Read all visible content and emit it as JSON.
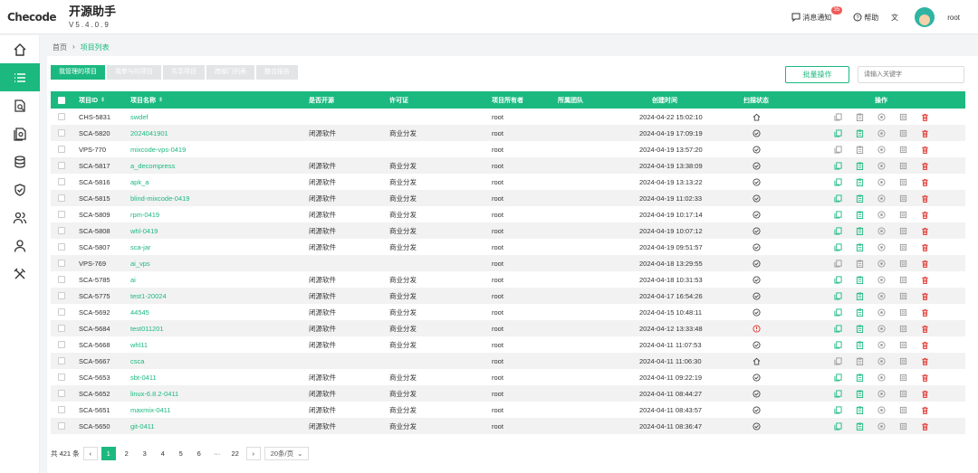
{
  "header": {
    "logo_text": "Checode",
    "app_name": "开源助手",
    "version": "V5.4.0.9",
    "messages_label": "消息通知",
    "messages_count": "35",
    "help_label": "帮助",
    "user_name": "root"
  },
  "sidebar": {
    "items": [
      {
        "name": "home",
        "icon": "home-icon",
        "active": false
      },
      {
        "name": "projects",
        "icon": "list-icon",
        "active": true
      },
      {
        "name": "scan",
        "icon": "doc-search-icon",
        "active": false
      },
      {
        "name": "compare",
        "icon": "doc-compare-icon",
        "active": false
      },
      {
        "name": "database",
        "icon": "database-icon",
        "active": false
      },
      {
        "name": "security",
        "icon": "shield-icon",
        "active": false
      },
      {
        "name": "users",
        "icon": "users-icon",
        "active": false
      },
      {
        "name": "user",
        "icon": "user-icon",
        "active": false
      },
      {
        "name": "tools",
        "icon": "tools-icon",
        "active": false
      }
    ]
  },
  "breadcrumb": {
    "home": "首页",
    "current": "项目列表"
  },
  "tabs": [
    "我管理的项目",
    "我参与的项目",
    "共享项目",
    "跨部门列表",
    "整合报告"
  ],
  "toolbar": {
    "batch_label": "批量操作",
    "search_placeholder": "请输入关键字"
  },
  "table": {
    "headers": {
      "id": "项目ID",
      "name": "项目名称",
      "open_source": "是否开源",
      "license": "许可证",
      "owner": "项目所有者",
      "team": "所属团队",
      "created": "创建时间",
      "scan_status": "扫描状态",
      "ops": "操作"
    },
    "rows": [
      {
        "id": "CHS-5831",
        "name": "swdef",
        "open": "",
        "license": "",
        "owner": "root",
        "time": "2024-04-22 15:02:10",
        "status": "home"
      },
      {
        "id": "SCA-5820",
        "name": "2024041901",
        "open": "闭源软件",
        "license": "商业分发",
        "owner": "root",
        "time": "2024-04-19 17:09:19",
        "status": "ok"
      },
      {
        "id": "VPS-770",
        "name": "mixcode-vps-0419",
        "open": "",
        "license": "",
        "owner": "root",
        "time": "2024-04-19 13:57:20",
        "status": "ok"
      },
      {
        "id": "SCA-5817",
        "name": "a_decompress",
        "open": "闭源软件",
        "license": "商业分发",
        "owner": "root",
        "time": "2024-04-19 13:38:09",
        "status": "ok"
      },
      {
        "id": "SCA-5816",
        "name": "apk_a",
        "open": "闭源软件",
        "license": "商业分发",
        "owner": "root",
        "time": "2024-04-19 13:13:22",
        "status": "ok"
      },
      {
        "id": "SCA-5815",
        "name": "blind-mixcode-0419",
        "open": "闭源软件",
        "license": "商业分发",
        "owner": "root",
        "time": "2024-04-19 11:02:33",
        "status": "ok"
      },
      {
        "id": "SCA-5809",
        "name": "rpm-0419",
        "open": "闭源软件",
        "license": "商业分发",
        "owner": "root",
        "time": "2024-04-19 10:17:14",
        "status": "ok"
      },
      {
        "id": "SCA-5808",
        "name": "whl-0419",
        "open": "闭源软件",
        "license": "商业分发",
        "owner": "root",
        "time": "2024-04-19 10:07:12",
        "status": "ok"
      },
      {
        "id": "SCA-5807",
        "name": "sca-jar",
        "open": "闭源软件",
        "license": "商业分发",
        "owner": "root",
        "time": "2024-04-19 09:51:57",
        "status": "ok"
      },
      {
        "id": "VPS-769",
        "name": "ai_vps",
        "open": "",
        "license": "",
        "owner": "root",
        "time": "2024-04-18 13:29:55",
        "status": "ok"
      },
      {
        "id": "SCA-5785",
        "name": "ai",
        "open": "闭源软件",
        "license": "商业分发",
        "owner": "root",
        "time": "2024-04-18 10:31:53",
        "status": "ok"
      },
      {
        "id": "SCA-5775",
        "name": "test1-20024",
        "open": "闭源软件",
        "license": "商业分发",
        "owner": "root",
        "time": "2024-04-17 16:54:26",
        "status": "ok"
      },
      {
        "id": "SCA-5692",
        "name": "44545",
        "open": "闭源软件",
        "license": "商业分发",
        "owner": "root",
        "time": "2024-04-15 10:48:11",
        "status": "ok"
      },
      {
        "id": "SCA-5684",
        "name": "test011201",
        "open": "闭源软件",
        "license": "商业分发",
        "owner": "root",
        "time": "2024-04-12 13:33:48",
        "status": "error"
      },
      {
        "id": "SCA-5668",
        "name": "whl11",
        "open": "闭源软件",
        "license": "商业分发",
        "owner": "root",
        "time": "2024-04-11 11:07:53",
        "status": "ok"
      },
      {
        "id": "SCA-5667",
        "name": "csca",
        "open": "",
        "license": "",
        "owner": "root",
        "time": "2024-04-11 11:06:30",
        "status": "home"
      },
      {
        "id": "SCA-5653",
        "name": "sbt-0411",
        "open": "闭源软件",
        "license": "商业分发",
        "owner": "root",
        "time": "2024-04-11 09:22:19",
        "status": "ok"
      },
      {
        "id": "SCA-5652",
        "name": "linux-6.8.2-0411",
        "open": "闭源软件",
        "license": "商业分发",
        "owner": "root",
        "time": "2024-04-11 08:44:27",
        "status": "ok"
      },
      {
        "id": "SCA-5651",
        "name": "maxmix-0411",
        "open": "闭源软件",
        "license": "商业分发",
        "owner": "root",
        "time": "2024-04-11 08:43:57",
        "status": "ok"
      },
      {
        "id": "SCA-5650",
        "name": "git-0411",
        "open": "闭源软件",
        "license": "商业分发",
        "owner": "root",
        "time": "2024-04-11 08:36:47",
        "status": "ok"
      }
    ]
  },
  "pagination": {
    "total": "共 421 条",
    "pages": [
      "1",
      "2",
      "3",
      "4",
      "5",
      "6",
      "···",
      "22"
    ],
    "page_size": "20条/页"
  },
  "colors": {
    "accent": "#1bb97f",
    "danger": "#e0302a"
  }
}
